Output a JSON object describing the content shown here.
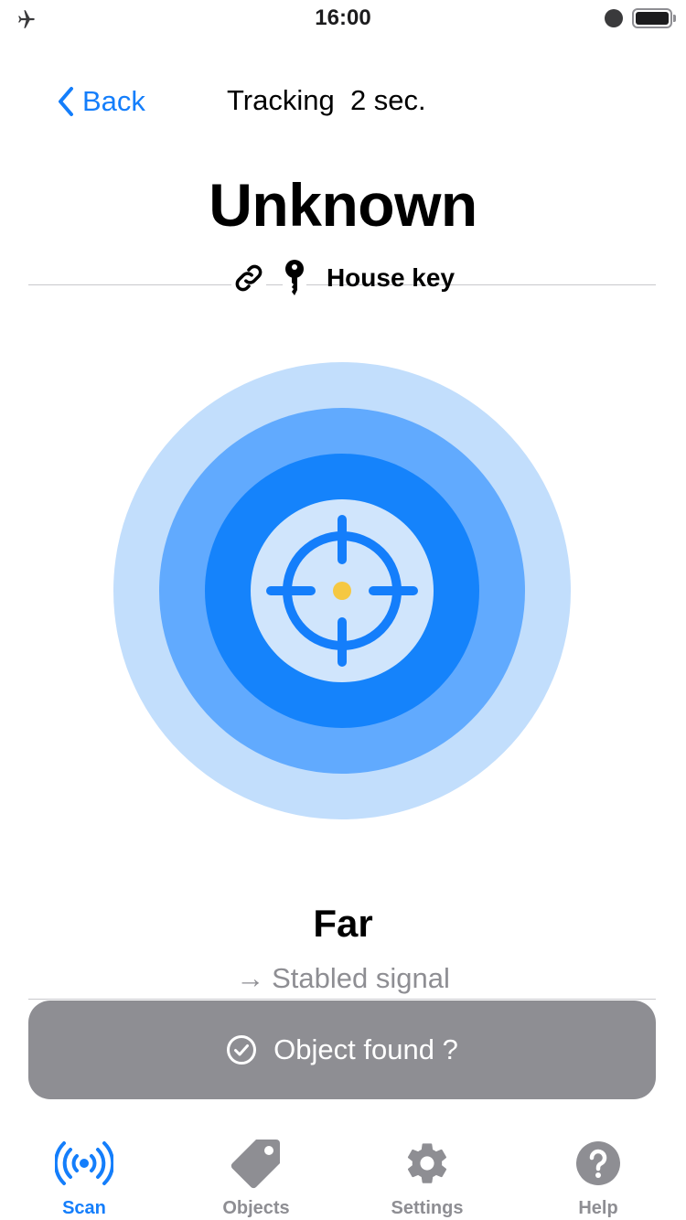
{
  "status_bar": {
    "time": "16:00"
  },
  "nav": {
    "back_label": "Back",
    "title": "Tracking  2 sec."
  },
  "object": {
    "title": "Unknown",
    "tag_label": "House key"
  },
  "radar": {
    "rings": [
      "#c2defc",
      "#61aafe",
      "#1583fb",
      "#d0e5fc"
    ],
    "target_color": "#147efb",
    "center_dot_color": "#f5c842"
  },
  "distance": {
    "label": "Far",
    "signal_arrow": "→",
    "signal_text": "Stabled signal"
  },
  "found_button": {
    "label": "Object found ?"
  },
  "tabs": [
    {
      "label": "Scan",
      "icon": "scan-icon",
      "active": true
    },
    {
      "label": "Objects",
      "icon": "tag-icon",
      "active": false
    },
    {
      "label": "Settings",
      "icon": "gear-icon",
      "active": false
    },
    {
      "label": "Help",
      "icon": "help-icon",
      "active": false
    }
  ],
  "colors": {
    "accent": "#147efb",
    "inactive": "#8e8e93",
    "button": "#8e8e93"
  }
}
